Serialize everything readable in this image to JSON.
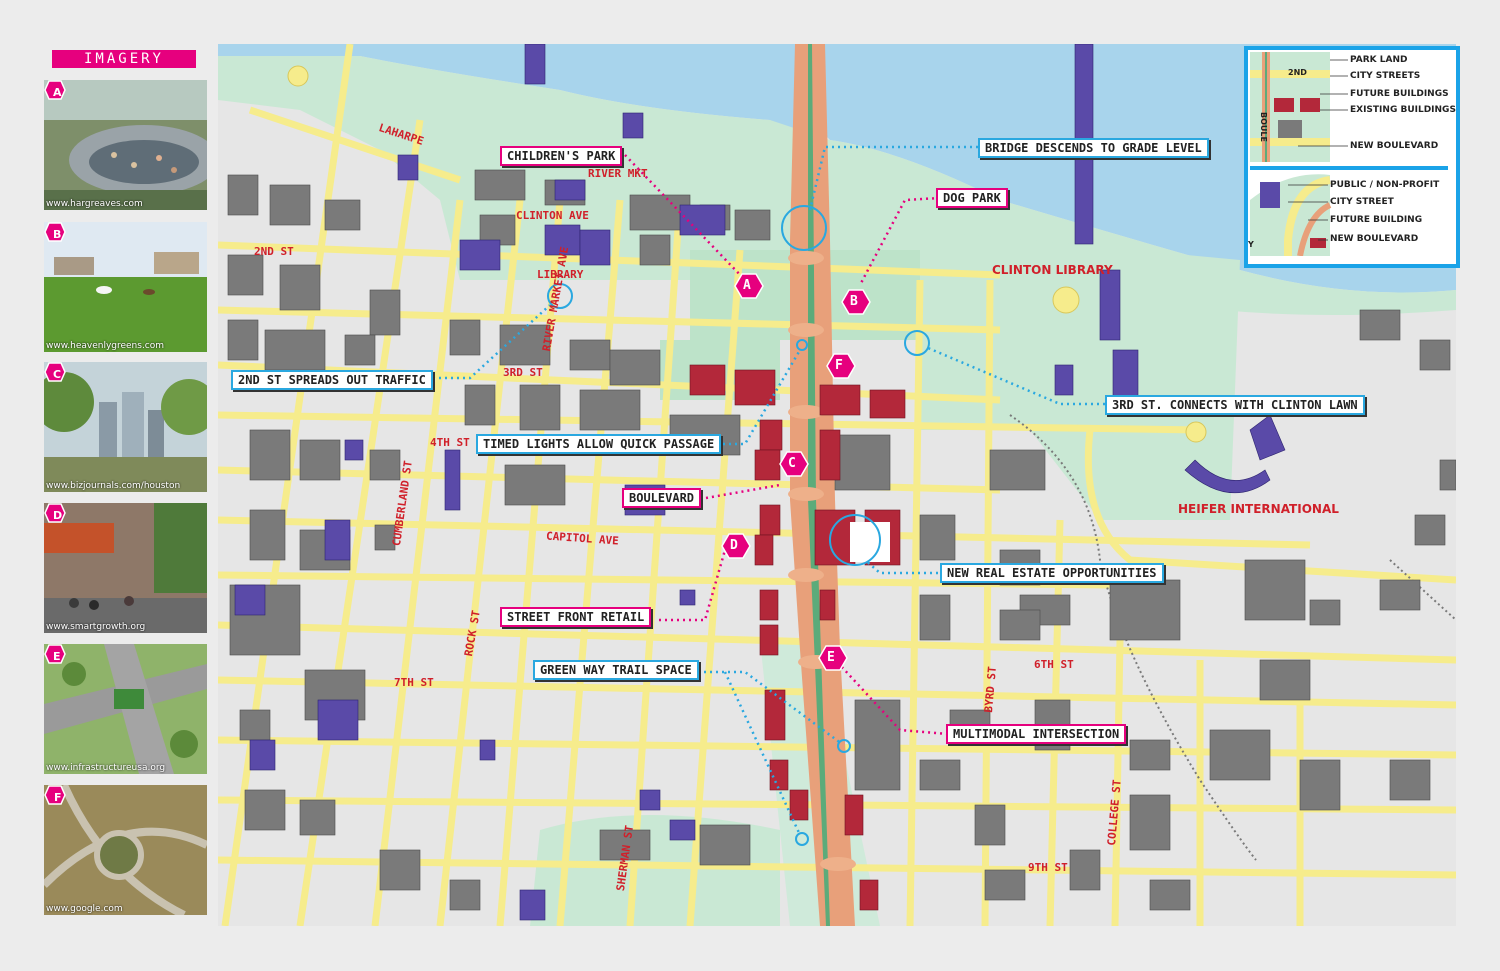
{
  "sidebar": {
    "title": "IMAGERY",
    "thumbnails": [
      {
        "letter": "A",
        "credit": "www.hargreaves.com"
      },
      {
        "letter": "B",
        "credit": "www.heavenlygreens.com"
      },
      {
        "letter": "C",
        "credit": "www.bizjournals.com/houston"
      },
      {
        "letter": "D",
        "credit": "www.smartgrowth.org"
      },
      {
        "letter": "E",
        "credit": "www.infrastructureusa.org"
      },
      {
        "letter": "F",
        "credit": "www.google.com"
      }
    ]
  },
  "map": {
    "street_labels": {
      "laharpe": "LAHARPE",
      "river_mkt": "RIVER MKT",
      "clinton_ave": "CLINTON AVE",
      "second_st": "2ND ST",
      "library": "LIBRARY",
      "third_st": "3RD ST",
      "river_market_ave": "RIVER MARKET AVE",
      "fourth_st": "4TH ST",
      "cumberland_st": "CUMBERLAND ST",
      "capitol_ave": "CAPITOL AVE",
      "rock_st": "ROCK ST",
      "seventh_st": "7TH ST",
      "sherman_st": "SHERMAN ST",
      "byrd_st": "BYRD ST",
      "sixth_st": "6TH ST",
      "college_st": "COLLEGE ST",
      "ninth_st": "9TH ST",
      "clinton_library": "CLINTON LIBRARY",
      "heifer_international": "HEIFER INTERNATIONAL"
    },
    "markers": [
      "A",
      "B",
      "C",
      "D",
      "E",
      "F"
    ],
    "callouts": {
      "childrens_park": "CHILDREN'S PARK",
      "bridge_descends": "BRIDGE DESCENDS TO GRADE LEVEL",
      "dog_park": "DOG PARK",
      "second_st_spreads": "2ND ST SPREADS OUT TRAFFIC",
      "third_st_connects": "3RD ST. CONNECTS WITH CLINTON LAWN",
      "timed_lights": "TIMED LIGHTS ALLOW QUICK PASSAGE",
      "boulevard": "BOULEVARD",
      "new_real_estate": "NEW REAL ESTATE OPPORTUNITIES",
      "street_front_retail": "STREET FRONT RETAIL",
      "green_way_trail": "GREEN WAY TRAIL SPACE",
      "multimodal_intersection": "MULTIMODAL INTERSECTION"
    }
  },
  "legend": {
    "top": {
      "street": "2ND",
      "side_label": "BOULE",
      "items": [
        "PARK LAND",
        "CITY STREETS",
        "FUTURE BUILDINGS",
        "EXISTING BUILDINGS",
        "NEW BOULEVARD"
      ]
    },
    "bottom": {
      "side_label": "Y",
      "items": [
        "PUBLIC / NON-PROFIT",
        "CITY STREET",
        "FUTURE BUILDING",
        "NEW BOULEVARD"
      ]
    }
  },
  "colors": {
    "water": "#a8d4ec",
    "park": "#c9e8d4",
    "street": "#f6ec8c",
    "existing_building": "#7a7a7a",
    "future_building": "#b3283a",
    "public_building": "#5a4aa8",
    "boulevard": "#e8a07a",
    "accent_pink": "#e6007e",
    "accent_blue": "#2aa8e0"
  }
}
